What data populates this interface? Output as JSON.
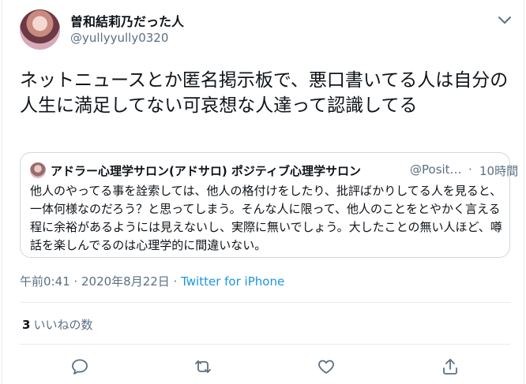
{
  "author": {
    "display_name": "曽和結莉乃だった人",
    "handle": "@yullyyully0320",
    "avatar_icon": "profile-photo"
  },
  "tweet": {
    "text": "ネットニュースとか匿名掲示板で、悪口書いてる人は自分の人生に満足してない可哀想な人達って認識してる"
  },
  "quoted_tweet": {
    "author_name": "アドラー心理学サロン(アドサロ) ポジティブ心理学サロン",
    "handle": "@Posit…",
    "separator": "·",
    "time": "10時間",
    "text": "他人のやってる事を詮索しては、他人の格付けをしたり、批評ばかりしてる人を見ると、一体何様なのだろう？と思ってしまう。そんな人に限って、他人のことをとやかく言える程に余裕があるようには見えないし、実際に無いでしょう。大したことの無い人ほど、噂話を楽しんでるのは心理学的に間違いない。"
  },
  "meta": {
    "timestamp": "午前0:41 · 2020年8月22日",
    "separator": " · ",
    "source": "Twitter for iPhone"
  },
  "stats": {
    "likes_count": "3",
    "likes_label": "いいねの数"
  },
  "actions": {
    "reply_icon": "reply-icon",
    "retweet_icon": "retweet-icon",
    "like_icon": "like-icon",
    "share_icon": "share-icon"
  },
  "colors": {
    "accent": "#1b95e0",
    "icon": "#5b7083",
    "secondary_text": "#5b7083",
    "border": "#e6ecf0"
  }
}
